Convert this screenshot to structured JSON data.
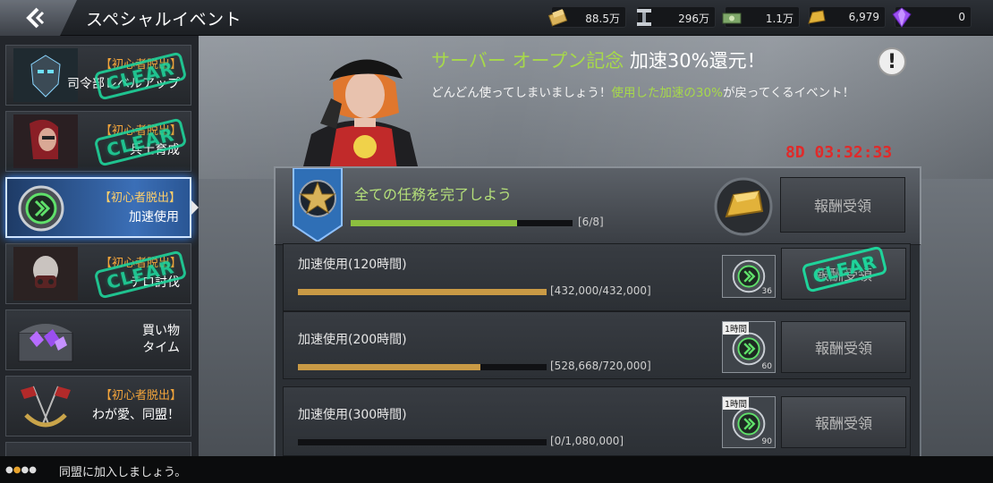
{
  "header": {
    "title": "スペシャルイベント",
    "resources": [
      {
        "icon": "gold-bar-stack-icon",
        "value": "88.5万"
      },
      {
        "icon": "steel-beam-icon",
        "value": "296万"
      },
      {
        "icon": "cash-stack-icon",
        "value": "1.1万"
      },
      {
        "icon": "gold-ingot-icon",
        "value": "6,979"
      },
      {
        "icon": "purple-gem-icon",
        "value": "0"
      }
    ]
  },
  "sidebar": {
    "items": [
      {
        "tag": "【初心者脱出】",
        "label_lines": [
          "司令部レベルアップ"
        ],
        "cleared": true
      },
      {
        "tag": "【初心者脱出】",
        "label_lines": [
          "兵士育成"
        ],
        "cleared": true
      },
      {
        "tag": "【初心者脱出】",
        "label_lines": [
          "加速使用"
        ],
        "cleared": false,
        "active": true
      },
      {
        "tag": "【初心者脱出】",
        "label_lines": [
          "テロ討伐"
        ],
        "cleared": true
      },
      {
        "tag": "",
        "label_lines": [
          "買い物",
          "タイム"
        ],
        "cleared": false
      },
      {
        "tag": "【初心者脱出】",
        "label_lines": [
          "わが愛、同盟！"
        ],
        "cleared": false
      }
    ],
    "clear_text": "CLEAR"
  },
  "event": {
    "title_highlight": "サーバー オープン記念",
    "title_rest": " 加速30%還元！",
    "desc_before": "どんどん使ってしまいましょう！",
    "desc_highlight": "使用した加速の30%",
    "desc_after": "が戻ってくるイベント！",
    "info_symbol": "!",
    "timer": "8D 03:32:33"
  },
  "summary": {
    "title": "全ての任務を完了しよう",
    "progress_text": "[6/8]",
    "progress": 0.75,
    "claim_label": "報酬受領"
  },
  "tasks": [
    {
      "title": "加速使用(120時間)",
      "progress_text": "[432,000/432,000]",
      "progress": 1.0,
      "reward_qty": "36",
      "reward_badge": "",
      "claim_label": "報酬受領",
      "cleared": true
    },
    {
      "title": "加速使用(200時間)",
      "progress_text": "[528,668/720,000]",
      "progress": 0.734,
      "reward_qty": "60",
      "reward_badge": "1時間",
      "claim_label": "報酬受領",
      "cleared": false
    },
    {
      "title": "加速使用(300時間)",
      "progress_text": "[0/1,080,000]",
      "progress": 0.0,
      "reward_qty": "90",
      "reward_badge": "1時間",
      "claim_label": "報酬受領",
      "cleared": false
    }
  ],
  "footer": {
    "text": "同盟に加入しましょう。"
  },
  "colors": {
    "accent_green": "#a7d94a",
    "clear_green": "#1fd39a",
    "timer_red": "#e02a2a",
    "progress_gold": "#c99a45",
    "progress_green": "#8cbf3f"
  }
}
